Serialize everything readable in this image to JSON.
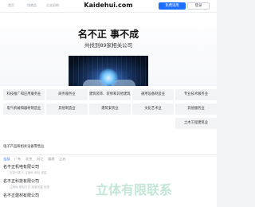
{
  "header": {
    "nav": [
      "首页",
      "找商品",
      "企业机构"
    ],
    "logo": "Kaidehui.com",
    "trial_button": "免费试用",
    "login_button": "登录"
  },
  "hero": {
    "title": "名不正 事不成",
    "subtitle": "共找到89家相关公司"
  },
  "categories": [
    "科技推广和应用服务业",
    "商务服务业",
    "建筑装饰、装修和其他建筑业",
    "通用设备制造业",
    "专业技术服务业",
    "电气机械和器材制造业",
    "其他制造业",
    "建筑安装业",
    "文化艺术业",
    "其他服务业",
    "土木工程建筑业"
  ],
  "categories_last": "电子产品和相关设备零售业",
  "tabs": [
    "全部",
    "广东",
    "北京",
    "浙江",
    "福建",
    "江苏"
  ],
  "companies": [
    {
      "name": "名不正机电有限公司",
      "sub": "法定代表人  注册地  地址 信息"
    },
    {
      "name": "名不正科技有限公司",
      "sub": "注册地  联系方式  经营范围 信息"
    },
    {
      "name": "名不正建材有限公司",
      "sub": ""
    }
  ],
  "watermark": "立体有限联系"
}
